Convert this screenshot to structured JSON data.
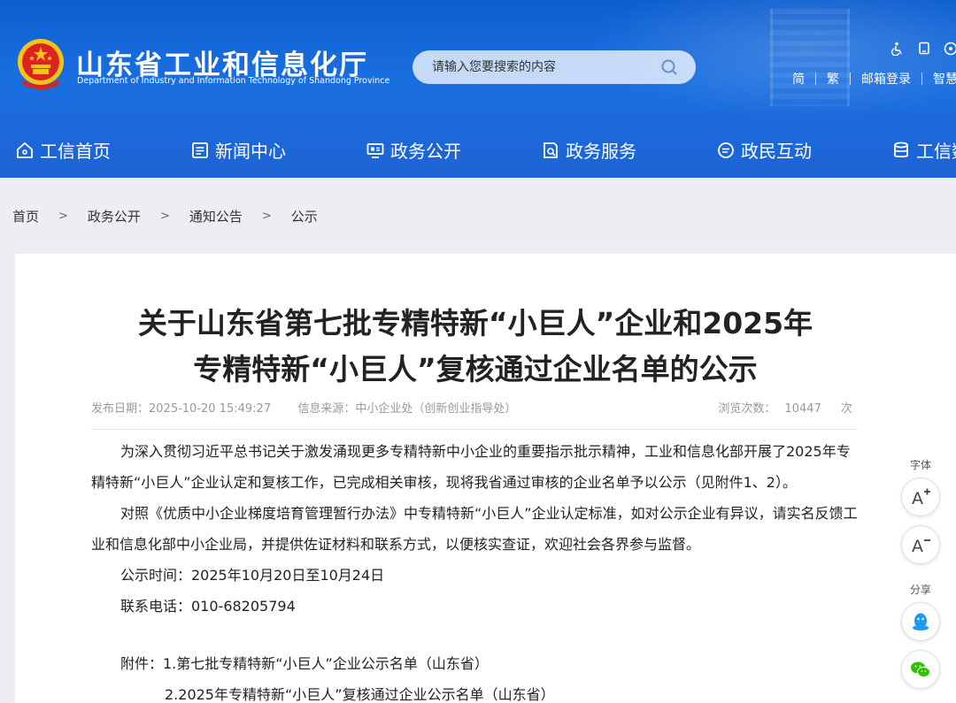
{
  "header": {
    "site_title": "山东省工业和信息化厅",
    "site_subtitle": "Department of Industry and Information Technology of Shandong Province",
    "search_placeholder": "请输入您要搜索的内容",
    "links": {
      "simplified": "简",
      "traditional": "繁",
      "mail_login": "邮箱登录",
      "smart": "智慧"
    },
    "icons": [
      "accessibility-icon",
      "mobile-icon",
      "wechat-mini-icon"
    ]
  },
  "nav": [
    {
      "label": "工信首页",
      "icon": "home-icon"
    },
    {
      "label": "新闻中心",
      "icon": "news-icon"
    },
    {
      "label": "政务公开",
      "icon": "monitor-icon"
    },
    {
      "label": "政务服务",
      "icon": "service-icon"
    },
    {
      "label": "政民互动",
      "icon": "chat-icon"
    },
    {
      "label": "工信数",
      "icon": "database-icon"
    }
  ],
  "breadcrumb": [
    "首页",
    "政务公开",
    "通知公告",
    "公示"
  ],
  "breadcrumb_sep": ">",
  "article": {
    "title_line1": "关于山东省第七批专精特新“小巨人”企业和2025年",
    "title_line2": "专精特新“小巨人”复核通过企业名单的公示",
    "publish_label": "发布日期：",
    "publish_date": "2025-10-20 15:49:27",
    "source_label": "信息来源：",
    "source": "中小企业处（创新创业指导处）",
    "views_label": "浏览次数：",
    "views": "10447",
    "views_unit": "次",
    "paragraphs": [
      "为深入贯彻习近平总书记关于激发涌现更多专精特新中小企业的重要指示批示精神，工业和信息化部开展了2025年专精特新“小巨人”企业认定和复核工作，已完成相关审核，现将我省通过审核的企业名单予以公示（见附件1、2）。",
      "对照《优质中小企业梯度培育管理暂行办法》中专精特新“小巨人”企业认定标准，如对公示企业有异议，请实名反馈工业和信息化部中小企业局，并提供佐证材料和联系方式，以便核实查证，欢迎社会各界参与监督。"
    ],
    "notice_time": "公示时间：2025年10月20日至10月24日",
    "contact_phone": "联系电话：010-68205794",
    "attachment_1": "附件：1.第七批专精特新“小巨人”企业公示名单（山东省）",
    "attachment_2": "2.2025年专精特新“小巨人”复核通过企业公示名单（山东省）"
  },
  "side_tools": {
    "font_label": "字体",
    "share_label": "分享"
  },
  "colors": {
    "header_blue": "#1a6fe0",
    "page_bg": "#eceef2",
    "emblem_red": "#d9251d",
    "emblem_gold": "#f5c518"
  }
}
